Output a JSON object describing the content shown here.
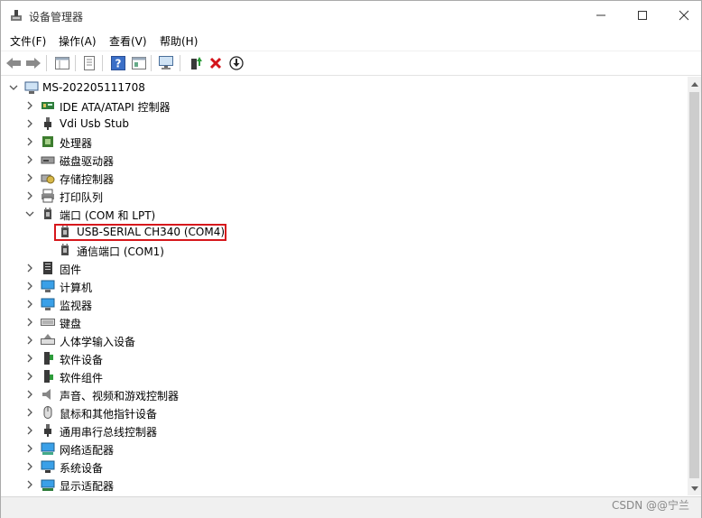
{
  "window": {
    "title": "设备管理器"
  },
  "menu": [
    "文件(F)",
    "操作(A)",
    "查看(V)",
    "帮助(H)"
  ],
  "toolbar_icons": [
    "back-arrow-icon",
    "forward-arrow-icon",
    "properties-grid-icon",
    "list-view-icon",
    "help-icon",
    "device-view-icon",
    "monitor-scan-icon",
    "update-driver-icon",
    "remove-x-icon",
    "download-circle-icon"
  ],
  "tree": {
    "root": "MS-202205111708",
    "items": [
      {
        "label": "IDE ATA/ATAPI 控制器",
        "icon": "ide-controller-icon",
        "expanded": false
      },
      {
        "label": "Vdi Usb Stub",
        "icon": "usb-plug-icon",
        "expanded": false
      },
      {
        "label": "处理器",
        "icon": "cpu-chip-icon",
        "expanded": false
      },
      {
        "label": "磁盘驱动器",
        "icon": "disk-drive-icon",
        "expanded": false
      },
      {
        "label": "存储控制器",
        "icon": "storage-controller-icon",
        "expanded": false
      },
      {
        "label": "打印队列",
        "icon": "printer-icon",
        "expanded": false
      },
      {
        "label": "端口 (COM 和 LPT)",
        "icon": "port-icon",
        "expanded": true,
        "children": [
          {
            "label": "USB-SERIAL CH340 (COM4)",
            "icon": "port-icon",
            "highlighted": true
          },
          {
            "label": "通信端口 (COM1)",
            "icon": "port-icon",
            "highlighted": false
          }
        ]
      },
      {
        "label": "固件",
        "icon": "firmware-icon",
        "expanded": false
      },
      {
        "label": "计算机",
        "icon": "computer-icon",
        "expanded": false
      },
      {
        "label": "监视器",
        "icon": "monitor-icon",
        "expanded": false
      },
      {
        "label": "键盘",
        "icon": "keyboard-icon",
        "expanded": false
      },
      {
        "label": "人体学输入设备",
        "icon": "hid-icon",
        "expanded": false
      },
      {
        "label": "软件设备",
        "icon": "software-device-icon",
        "expanded": false
      },
      {
        "label": "软件组件",
        "icon": "software-component-icon",
        "expanded": false
      },
      {
        "label": "声音、视频和游戏控制器",
        "icon": "speaker-icon",
        "expanded": false
      },
      {
        "label": "鼠标和其他指针设备",
        "icon": "mouse-icon",
        "expanded": false
      },
      {
        "label": "通用串行总线控制器",
        "icon": "usb-plug-icon",
        "expanded": false
      },
      {
        "label": "网络适配器",
        "icon": "network-adapter-icon",
        "expanded": false
      },
      {
        "label": "系统设备",
        "icon": "system-device-icon",
        "expanded": false
      },
      {
        "label": "显示适配器",
        "icon": "display-adapter-icon",
        "expanded": false
      }
    ]
  },
  "watermark": "CSDN @@宁兰",
  "colors": {
    "highlight_border": "#d6171c"
  }
}
